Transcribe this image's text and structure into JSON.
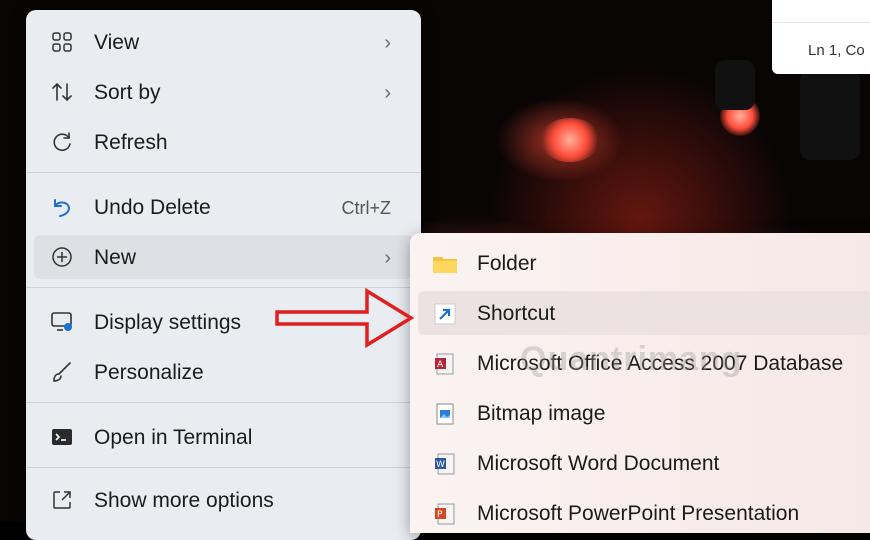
{
  "notepad": {
    "position": "Ln 1, Co"
  },
  "menu": {
    "items": [
      {
        "label": "View",
        "icon": "view-grid-icon",
        "chevron": "›"
      },
      {
        "label": "Sort by",
        "icon": "sort-arrows-icon",
        "chevron": "›"
      },
      {
        "label": "Refresh",
        "icon": "refresh-icon"
      },
      {
        "label": "Undo Delete",
        "icon": "undo-icon",
        "shortcut": "Ctrl+Z"
      },
      {
        "label": "New",
        "icon": "plus-circle-icon",
        "chevron": "›"
      },
      {
        "label": "Display settings",
        "icon": "display-icon"
      },
      {
        "label": "Personalize",
        "icon": "brush-icon"
      },
      {
        "label": "Open in Terminal",
        "icon": "terminal-icon"
      },
      {
        "label": "Show more options",
        "icon": "more-options-icon"
      }
    ]
  },
  "submenu": {
    "items": [
      {
        "label": "Folder",
        "icon": "folder-icon"
      },
      {
        "label": "Shortcut",
        "icon": "shortcut-icon"
      },
      {
        "label": "Microsoft Office Access 2007 Database",
        "icon": "access-icon"
      },
      {
        "label": "Bitmap image",
        "icon": "bitmap-icon"
      },
      {
        "label": "Microsoft Word Document",
        "icon": "word-icon"
      },
      {
        "label": "Microsoft PowerPoint Presentation",
        "icon": "powerpoint-icon"
      }
    ]
  },
  "watermark": "Quantrimang",
  "colors": {
    "menu_bg": "#e9ecf1",
    "arrow": "#e02020",
    "accent": "#1a6fd1"
  }
}
